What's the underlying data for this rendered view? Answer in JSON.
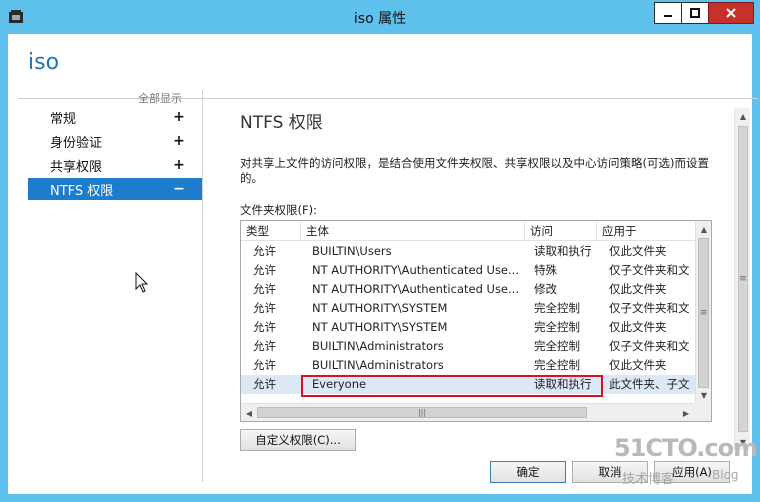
{
  "window": {
    "title": "iso 属性",
    "controls": {
      "minimize": "minimize-icon",
      "maximize": "maximize-icon",
      "close": "close-icon"
    }
  },
  "header": {
    "title": "iso"
  },
  "nav": {
    "show_all": "全部显示",
    "items": [
      {
        "label": "常规",
        "sign": "+"
      },
      {
        "label": "身份验证",
        "sign": "+"
      },
      {
        "label": "共享权限",
        "sign": "+"
      },
      {
        "label": "NTFS 权限",
        "sign": "−",
        "selected": true
      }
    ]
  },
  "main": {
    "title": "NTFS 权限",
    "description": "对共享上文件的访问权限，是结合使用文件夹权限、共享权限以及中心访问策略(可选)而设置的。",
    "list_label": "文件夹权限(F):",
    "columns": [
      "类型",
      "主体",
      "访问",
      "应用于"
    ],
    "rows": [
      {
        "type": "允许",
        "principal": "BUILTIN\\Users",
        "access": "读取和执行",
        "applies": "仅此文件夹"
      },
      {
        "type": "允许",
        "principal": "NT AUTHORITY\\Authenticated Use...",
        "access": "特殊",
        "applies": "仅子文件夹和文"
      },
      {
        "type": "允许",
        "principal": "NT AUTHORITY\\Authenticated Use...",
        "access": "修改",
        "applies": "仅此文件夹"
      },
      {
        "type": "允许",
        "principal": "NT AUTHORITY\\SYSTEM",
        "access": "完全控制",
        "applies": "仅子文件夹和文"
      },
      {
        "type": "允许",
        "principal": "NT AUTHORITY\\SYSTEM",
        "access": "完全控制",
        "applies": "仅此文件夹"
      },
      {
        "type": "允许",
        "principal": "BUILTIN\\Administrators",
        "access": "完全控制",
        "applies": "仅子文件夹和文"
      },
      {
        "type": "允许",
        "principal": "BUILTIN\\Administrators",
        "access": "完全控制",
        "applies": "仅此文件夹"
      },
      {
        "type": "允许",
        "principal": "Everyone",
        "access": "读取和执行",
        "applies": "此文件夹、子文",
        "selected": true
      }
    ],
    "custom_button": "自定义权限(C)..."
  },
  "footer": {
    "ok": "确定",
    "cancel": "取消",
    "apply": "应用(A)"
  },
  "watermark": {
    "main": "51CTO.com",
    "sub": "技术博客",
    "blog": "Blog"
  },
  "colors": {
    "titlebar": "#5ec0ec",
    "accent": "#1d7ccc",
    "header_text": "#1f74b6",
    "highlight": "#d8131f"
  }
}
